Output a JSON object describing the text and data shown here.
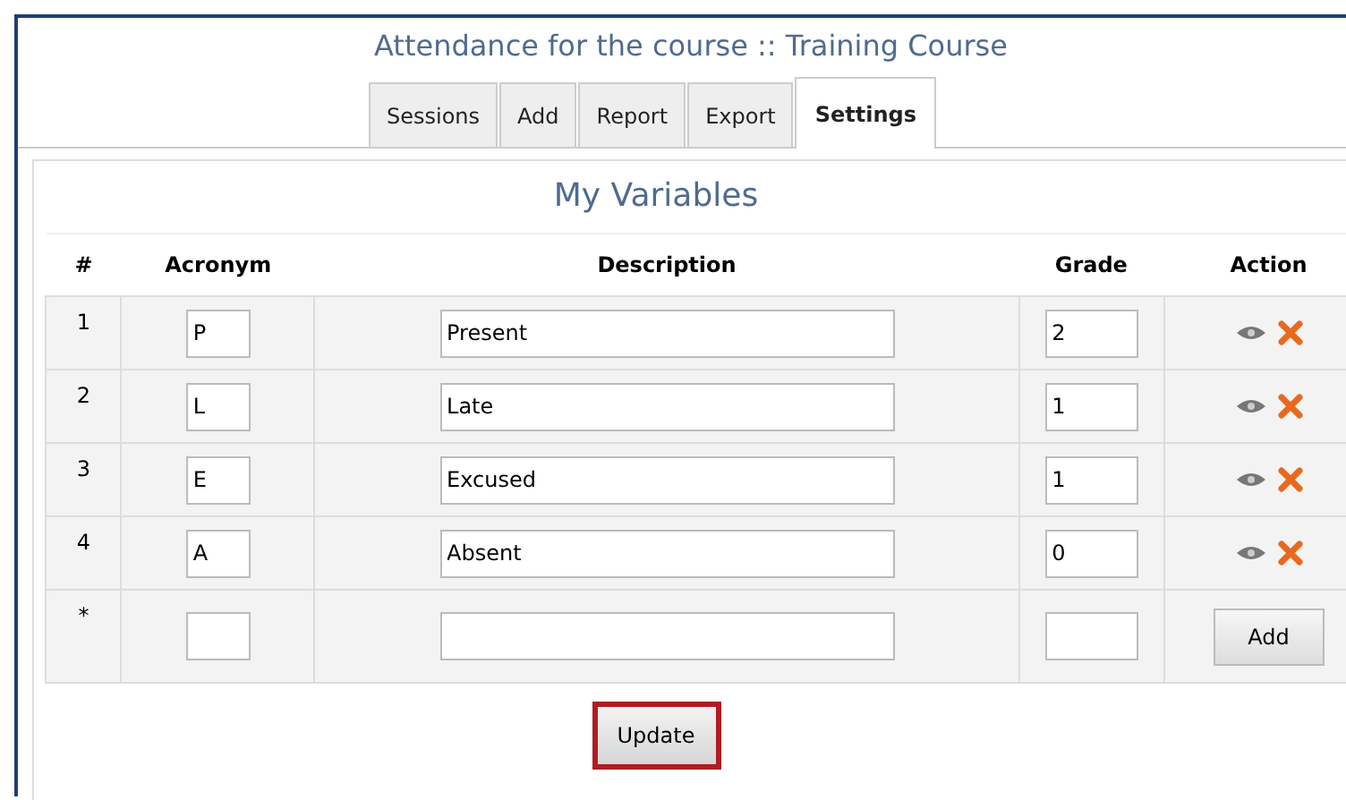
{
  "title": "Attendance for the course :: Training Course",
  "tabs": [
    {
      "label": "Sessions",
      "selected": false
    },
    {
      "label": "Add",
      "selected": false
    },
    {
      "label": "Report",
      "selected": false
    },
    {
      "label": "Export",
      "selected": false
    },
    {
      "label": "Settings",
      "selected": true
    }
  ],
  "panel_title": "My Variables",
  "table": {
    "columns": [
      "#",
      "Acronym",
      "Description",
      "Grade",
      "Action"
    ],
    "rows": [
      {
        "number": "1",
        "acronym": "P",
        "description": "Present",
        "grade": "2"
      },
      {
        "number": "2",
        "acronym": "L",
        "description": "Late",
        "grade": "1"
      },
      {
        "number": "3",
        "acronym": "E",
        "description": "Excused",
        "grade": "1"
      },
      {
        "number": "4",
        "acronym": "A",
        "description": "Absent",
        "grade": "0"
      }
    ],
    "new_row": {
      "number": "*",
      "button": "Add"
    }
  },
  "update_button": "Update"
}
